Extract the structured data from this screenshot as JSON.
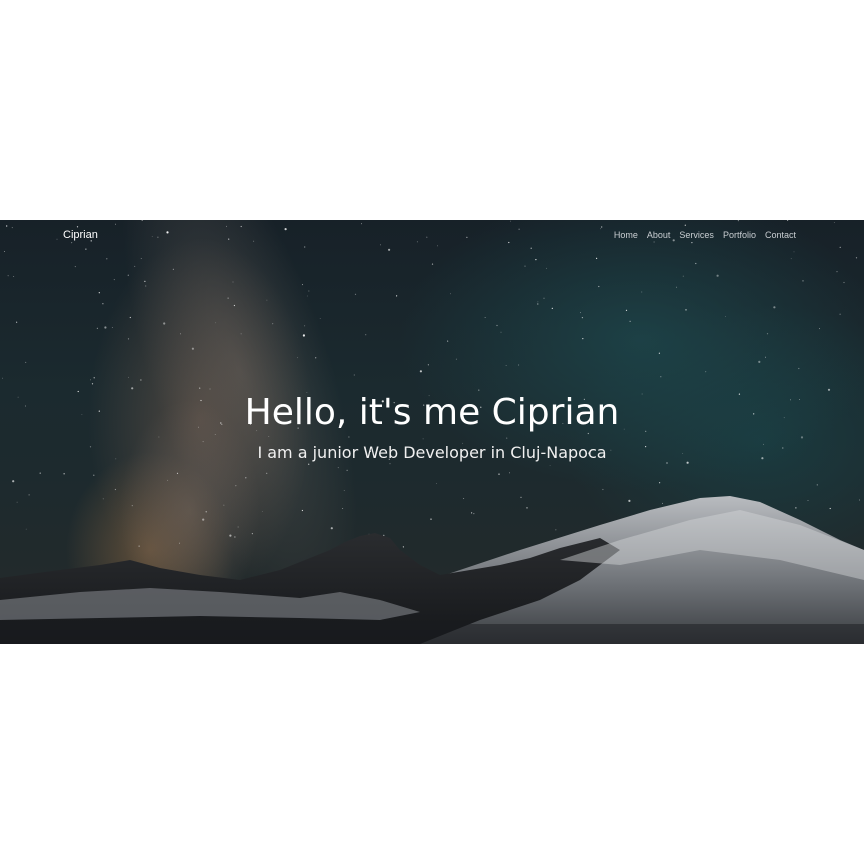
{
  "navbar": {
    "brand": "Ciprian",
    "links": [
      "Home",
      "About",
      "Services",
      "Portfolio",
      "Contact"
    ]
  },
  "hero": {
    "title": "Hello, it's me Ciprian",
    "subtitle": "I am a junior Web Developer in Cluj-Napoca"
  },
  "colors": {
    "page_background": "#ffffff",
    "sky": "#1b2a2f",
    "text": "#ffffff",
    "nav_link": "#c9ced2"
  }
}
